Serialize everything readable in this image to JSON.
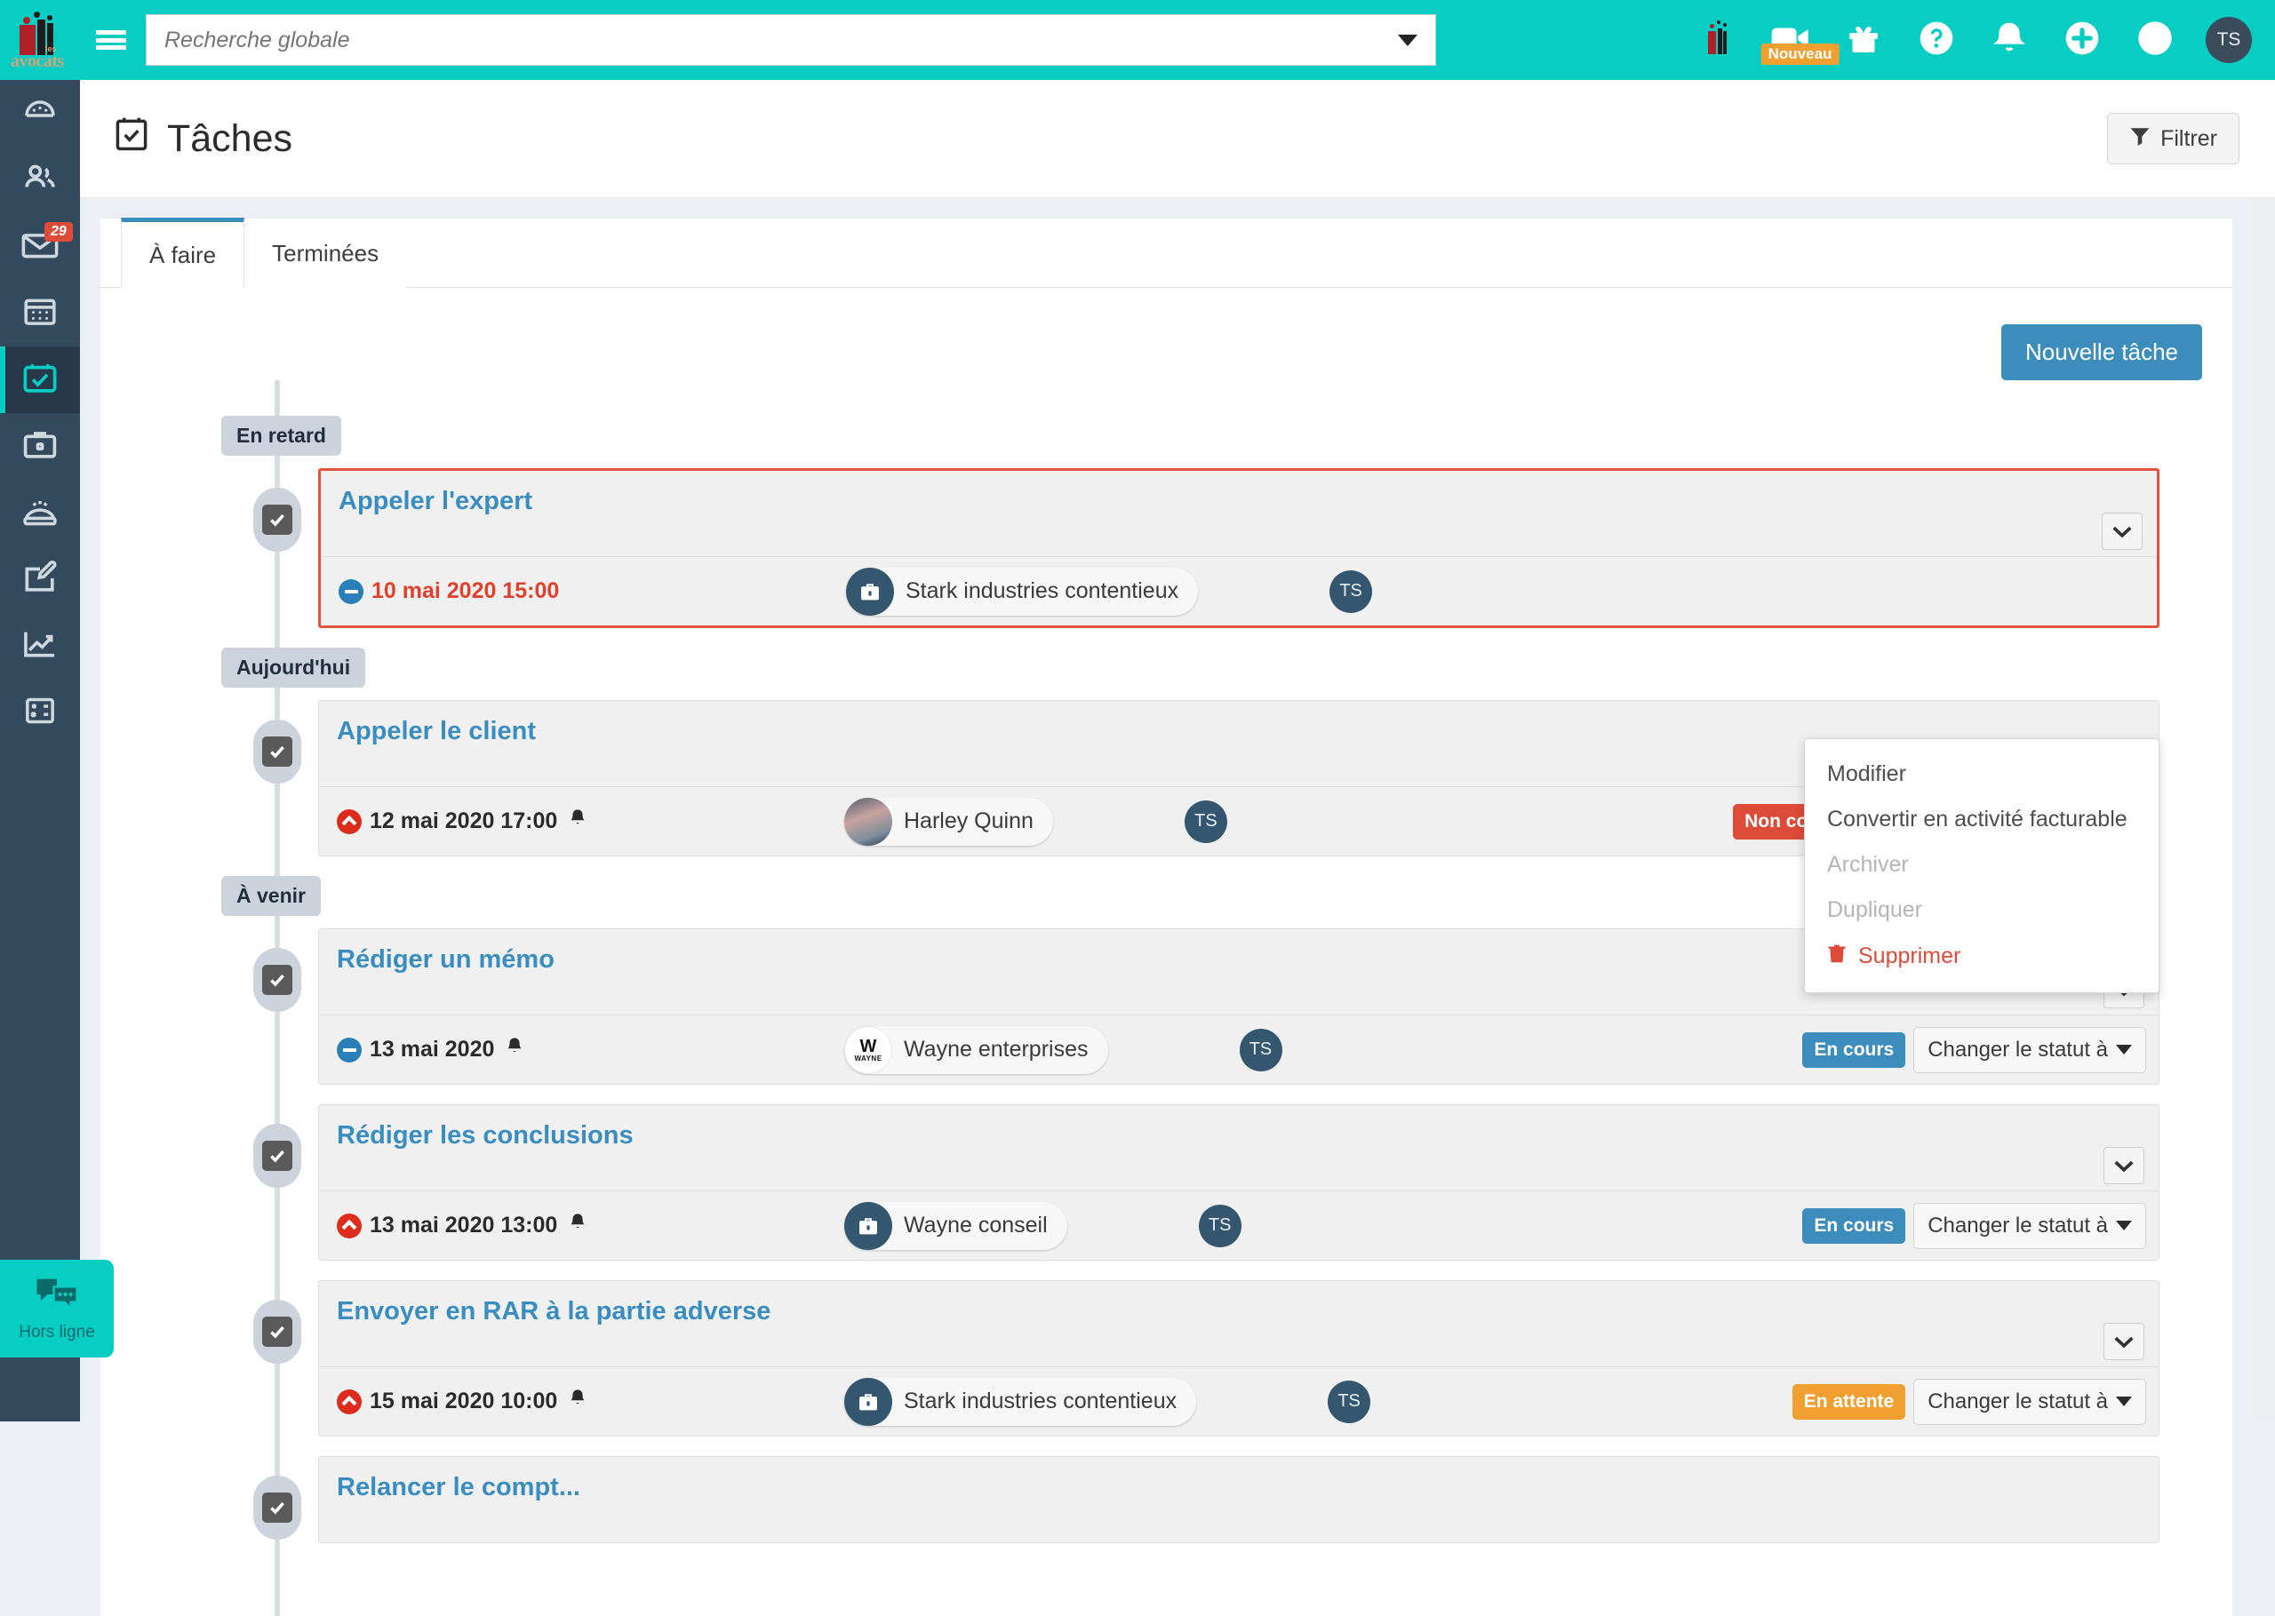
{
  "brand": {
    "logo_text_top": "les",
    "logo_text": "avocats",
    "accent_teal": "#07cdc3",
    "sidebar_navy": "#32495e",
    "primary_blue": "#3c8dbc",
    "danger_red": "#dd4b39",
    "warning_orange": "#f0a030"
  },
  "topbar": {
    "search": {
      "placeholder": "Recherche globale",
      "value": ""
    },
    "icons": [
      {
        "name": "brand-mini-logo-icon",
        "label": ""
      },
      {
        "name": "video-camera-icon",
        "label": "",
        "badge": "Nouveau"
      },
      {
        "name": "gift-icon",
        "label": ""
      },
      {
        "name": "help-circle-icon",
        "label": ""
      },
      {
        "name": "bell-icon",
        "label": ""
      },
      {
        "name": "plus-circle-icon",
        "label": ""
      },
      {
        "name": "clock-icon",
        "label": ""
      }
    ],
    "avatar_initials": "TS"
  },
  "sidebar": {
    "items": [
      {
        "name": "dashboard",
        "icon": "gauge-icon",
        "badge": null,
        "active": false
      },
      {
        "name": "contacts",
        "icon": "users-icon",
        "badge": null,
        "active": false
      },
      {
        "name": "messages",
        "icon": "envelope-icon",
        "badge": "29",
        "active": false
      },
      {
        "name": "agenda",
        "icon": "calendar-icon",
        "badge": null,
        "active": false
      },
      {
        "name": "tasks",
        "icon": "calendar-check-icon",
        "badge": null,
        "active": true
      },
      {
        "name": "cases",
        "icon": "briefcase-icon",
        "badge": null,
        "active": false
      },
      {
        "name": "scan",
        "icon": "scanner-icon",
        "badge": null,
        "active": false
      },
      {
        "name": "documents",
        "icon": "edit-document-icon",
        "badge": null,
        "active": false
      },
      {
        "name": "reports",
        "icon": "chart-line-icon",
        "badge": null,
        "active": false
      },
      {
        "name": "accounting",
        "icon": "calculator-icon",
        "badge": null,
        "active": false
      }
    ]
  },
  "chat_widget": {
    "label": "Hors ligne",
    "icon": "chat-bubbles-icon"
  },
  "page": {
    "title": "Tâches",
    "title_icon": "calendar-check-icon",
    "filter_button": {
      "label": "Filtrer",
      "icon": "funnel-icon"
    },
    "new_task_button": "Nouvelle tâche"
  },
  "tabs": [
    {
      "label": "À faire",
      "active": true
    },
    {
      "label": "Terminées",
      "active": false
    }
  ],
  "groups": [
    {
      "label": "En retard",
      "tasks": [
        {
          "title": "Appeler l'expert",
          "date": "10 mai 2020 15:00",
          "date_state": "overdue",
          "priority_icon": "minus-circle-blue-icon",
          "has_reminder": false,
          "entity": {
            "name": "Stark industries contentieux",
            "avatar": "briefcase-icon",
            "avatar_kind": "case"
          },
          "assignee": "TS",
          "status": null,
          "status_color": null,
          "status_change_label": null,
          "highlighted": true,
          "menu_open": true
        }
      ]
    },
    {
      "label": "Aujourd'hui",
      "tasks": [
        {
          "title": "Appeler le client",
          "date": "12 mai 2020 17:00",
          "date_state": "normal",
          "priority_icon": "urgent-red-icon",
          "has_reminder": true,
          "entity": {
            "name": "Harley Quinn",
            "avatar": "person-photo",
            "avatar_kind": "person"
          },
          "assignee": "TS",
          "status": "Non commencée",
          "status_color": "red",
          "status_change_label": "Changer le statut à",
          "highlighted": false,
          "menu_open": false
        }
      ]
    },
    {
      "label": "À venir",
      "tasks": [
        {
          "title": "Rédiger un mémo",
          "date": "13 mai 2020",
          "date_state": "normal",
          "priority_icon": "minus-circle-blue-icon",
          "has_reminder": true,
          "entity": {
            "name": "Wayne enterprises",
            "avatar": "wayne-logo",
            "avatar_kind": "company"
          },
          "assignee": "TS",
          "status": "En cours",
          "status_color": "blue",
          "status_change_label": "Changer le statut à",
          "highlighted": false,
          "menu_open": false
        },
        {
          "title": "Rédiger les conclusions",
          "date": "13 mai 2020 13:00",
          "date_state": "normal",
          "priority_icon": "urgent-red-icon",
          "has_reminder": true,
          "entity": {
            "name": "Wayne conseil",
            "avatar": "briefcase-icon",
            "avatar_kind": "case"
          },
          "assignee": "TS",
          "status": "En cours",
          "status_color": "blue",
          "status_change_label": "Changer le statut à",
          "highlighted": false,
          "menu_open": false
        },
        {
          "title": "Envoyer en RAR à la partie adverse",
          "date": "15 mai 2020 10:00",
          "date_state": "normal",
          "priority_icon": "urgent-red-icon",
          "has_reminder": true,
          "entity": {
            "name": "Stark industries contentieux",
            "avatar": "briefcase-icon",
            "avatar_kind": "case"
          },
          "assignee": "TS",
          "status": "En attente",
          "status_color": "orange",
          "status_change_label": "Changer le statut à",
          "highlighted": false,
          "menu_open": false
        },
        {
          "title": "Relancer le compt...",
          "date": "",
          "date_state": "normal",
          "priority_icon": null,
          "has_reminder": false,
          "entity": null,
          "assignee": "",
          "status": null,
          "status_color": null,
          "status_change_label": null,
          "highlighted": false,
          "menu_open": false,
          "clipped": true
        }
      ]
    }
  ],
  "task_menu": {
    "items": [
      {
        "label": "Modifier",
        "disabled": false,
        "danger": false,
        "icon": null
      },
      {
        "label": "Convertir en activité facturable",
        "disabled": false,
        "danger": false,
        "icon": null
      },
      {
        "label": "Archiver",
        "disabled": true,
        "danger": false,
        "icon": null
      },
      {
        "label": "Dupliquer",
        "disabled": true,
        "danger": false,
        "icon": null
      },
      {
        "label": "Supprimer",
        "disabled": false,
        "danger": true,
        "icon": "trash-icon"
      }
    ]
  }
}
